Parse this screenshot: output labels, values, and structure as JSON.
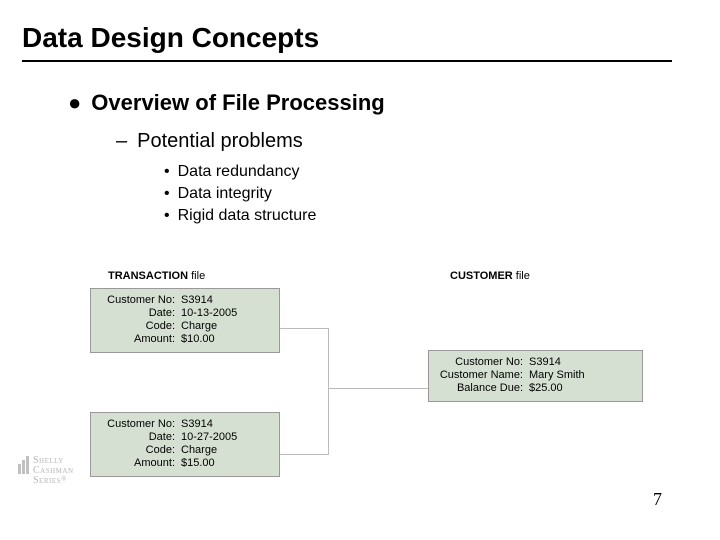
{
  "title": "Data Design Concepts",
  "outline": {
    "l1": "Overview of File Processing",
    "l2": "Potential problems",
    "l3": [
      "Data redundancy",
      "Data integrity",
      "Rigid data structure"
    ]
  },
  "figure": {
    "transaction_label": "TRANSACTION",
    "transaction_suffix": " file",
    "customer_label": "CUSTOMER",
    "customer_suffix": " file",
    "t1": {
      "customer_no_label": "Customer No:",
      "customer_no": "S3914",
      "date_label": "Date:",
      "date": "10-13-2005",
      "code_label": "Code:",
      "code": "Charge",
      "amount_label": "Amount:",
      "amount": "$10.00"
    },
    "t2": {
      "customer_no_label": "Customer No:",
      "customer_no": "S3914",
      "date_label": "Date:",
      "date": "10-27-2005",
      "code_label": "Code:",
      "code": "Charge",
      "amount_label": "Amount:",
      "amount": "$15.00"
    },
    "cust": {
      "customer_no_label": "Customer No:",
      "customer_no": "S3914",
      "customer_name_label": "Customer Name:",
      "customer_name": "Mary Smith",
      "balance_due_label": "Balance Due:",
      "balance_due": "$25.00"
    }
  },
  "logo": {
    "line1": "Shelly",
    "line2": "Cashman",
    "line3": "Series",
    "reg": "®"
  },
  "page_number": "7"
}
